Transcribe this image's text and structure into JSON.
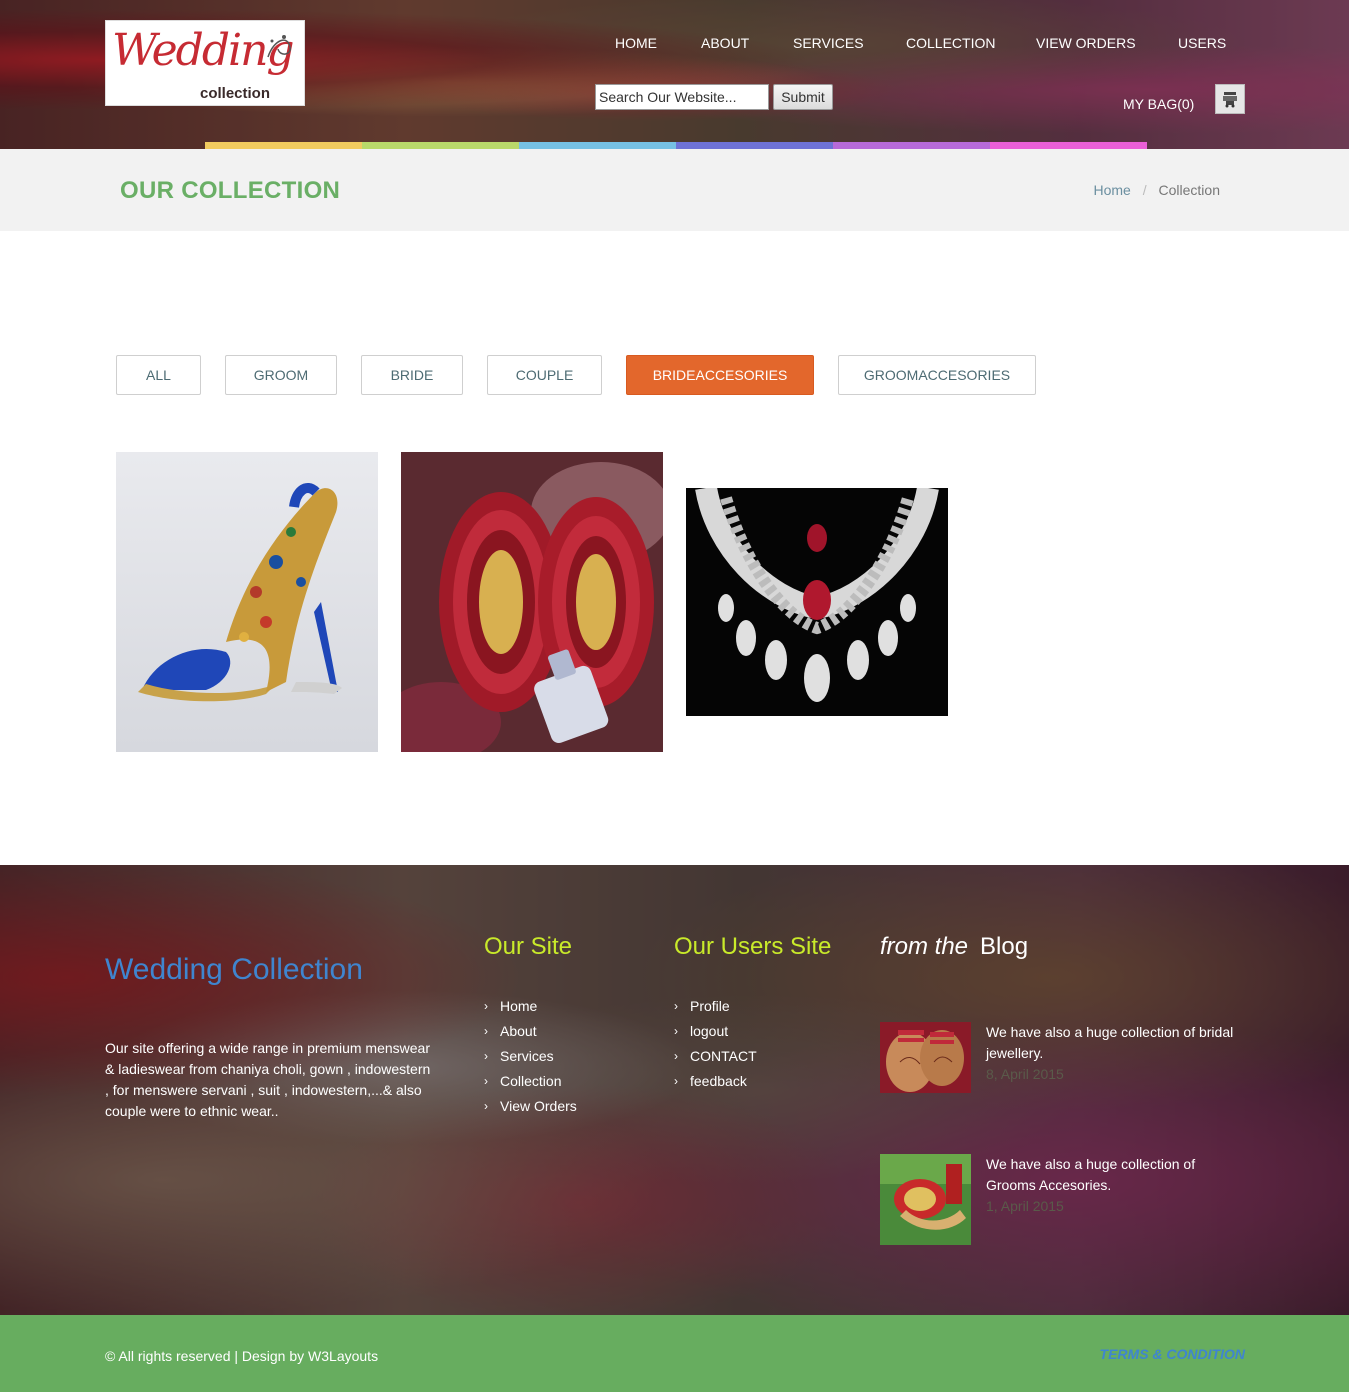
{
  "logo": {
    "script": "Wedding",
    "sub": "collection"
  },
  "nav": [
    {
      "label": "HOME"
    },
    {
      "label": "ABOUT"
    },
    {
      "label": "SERVICES"
    },
    {
      "label": "COLLECTION"
    },
    {
      "label": "VIEW ORDERS"
    },
    {
      "label": "USERS"
    }
  ],
  "search": {
    "placeholder": "Search Our Website...",
    "value": "",
    "submit_label": "Submit"
  },
  "bag": {
    "label": "MY BAG(0)",
    "icon": "cart-icon"
  },
  "colors": {
    "accent_stripe": [
      "#f1cb5f",
      "#b9d96a",
      "#76c0e3",
      "#6e72d6",
      "#b76ad9",
      "#ea5fd7"
    ],
    "title_green": "#6aaf66",
    "active_filter": "#e3672c",
    "footer_heading": "#c9ea2a",
    "brand_blue": "#3f85cf",
    "bottom_bar": "#67ad5f"
  },
  "page": {
    "title": "OUR COLLECTION",
    "breadcrumb": {
      "home": "Home",
      "separator": "/",
      "current": "Collection"
    }
  },
  "filters": [
    {
      "label": "ALL",
      "active": false
    },
    {
      "label": "GROOM",
      "active": false
    },
    {
      "label": "BRIDE",
      "active": false
    },
    {
      "label": "COUPLE",
      "active": false
    },
    {
      "label": "BRIDEACCESORIES",
      "active": true
    },
    {
      "label": "GROOMACCESORIES",
      "active": false
    }
  ],
  "gallery": [
    {
      "subject": "bridal-sandal"
    },
    {
      "subject": "bridal-bangles"
    },
    {
      "subject": "diamond-necklace"
    }
  ],
  "footer": {
    "brand": "Wedding Collection",
    "about": "Our site offering a wide range in premium menswear & ladieswear from chaniya choli, gown , indowestern , for menswere servani , suit , indowestern,...& also couple were to ethnic wear..",
    "our_site": {
      "title": "Our Site",
      "links": [
        "Home",
        "About",
        "Services",
        "Collection",
        "View Orders"
      ]
    },
    "users_site": {
      "title": "Our Users Site",
      "links": [
        "Profile",
        "logout",
        "CONTACT",
        "feedback"
      ]
    },
    "blog": {
      "title_from": "from the",
      "title_blog": "Blog",
      "posts": [
        {
          "text": "We have also a huge collection of bridal jewellery.",
          "date": "8, April 2015"
        },
        {
          "text": "We have also a huge collection of Grooms Accesories.",
          "date": "1, April 2015"
        }
      ]
    }
  },
  "bottom": {
    "copyright": "© All rights reserved | Design by W3Layouts",
    "terms": "TERMS & CONDITION"
  }
}
